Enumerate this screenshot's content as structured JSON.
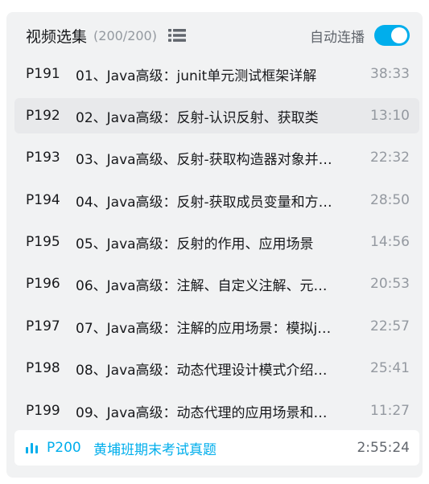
{
  "header": {
    "title": "视频选集",
    "count": "(200/200)",
    "autoplay_label": "自动连播",
    "autoplay_on": true
  },
  "items": [
    {
      "ep": "P191",
      "title": "01、Java高级：junit单元测试框架详解",
      "duration": "38:33"
    },
    {
      "ep": "P192",
      "title": "02、Java高级：反射-认识反射、获取类",
      "duration": "13:10"
    },
    {
      "ep": "P193",
      "title": "03、Java高级、反射-获取构造器对象并…",
      "duration": "22:32"
    },
    {
      "ep": "P194",
      "title": "04、Java高级：反射-获取成员变量和方…",
      "duration": "28:50"
    },
    {
      "ep": "P195",
      "title": "05、Java高级：反射的作用、应用场景",
      "duration": "14:56"
    },
    {
      "ep": "P196",
      "title": "06、Java高级：注解、自定义注解、元…",
      "duration": "20:53"
    },
    {
      "ep": "P197",
      "title": "07、Java高级：注解的应用场景：模拟j…",
      "duration": "22:57"
    },
    {
      "ep": "P198",
      "title": "08、Java高级：动态代理设计模式介绍…",
      "duration": "25:41"
    },
    {
      "ep": "P199",
      "title": "09、Java高级：动态代理的应用场景和…",
      "duration": "11:27"
    }
  ],
  "current": {
    "ep": "P200",
    "title": "黄埔班期末考试真题",
    "duration": "2:55:24"
  },
  "colors": {
    "accent": "#00aeec",
    "panel_bg": "#f1f2f3",
    "muted": "#9499a0"
  }
}
